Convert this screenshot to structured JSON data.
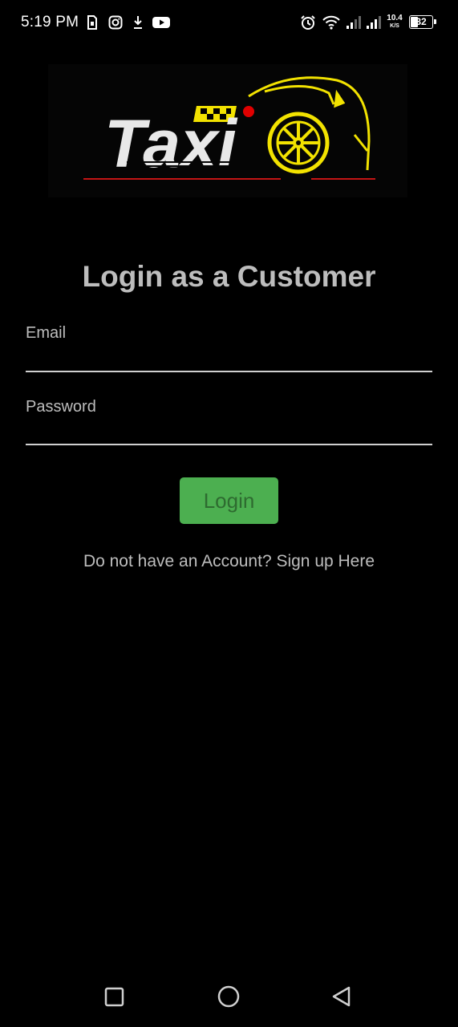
{
  "status_bar": {
    "time": "5:19 PM",
    "net_speed_value": "10.4",
    "net_speed_unit": "K/S",
    "battery": "32",
    "icons": [
      "sim-icon",
      "instagram-icon",
      "download-icon",
      "youtube-icon",
      "alarm-icon",
      "wifi-icon",
      "signal-icon",
      "signal-icon-2",
      "battery-icon"
    ]
  },
  "logo": {
    "text": "Taxi",
    "colors": {
      "text": "#e8e8e8",
      "accent": "#f2e200",
      "line": "#c41515",
      "dot": "#e00000"
    }
  },
  "login": {
    "title": "Login as a Customer",
    "email_label": "Email",
    "email_value": "",
    "password_label": "Password",
    "password_value": "",
    "button_label": "Login",
    "signup_text": "Do not have an Account? Sign up Here"
  },
  "nav_bar": {
    "icons": [
      "recents-square-icon",
      "home-circle-icon",
      "back-triangle-icon"
    ]
  },
  "colors": {
    "background": "#000000",
    "text_muted": "#bdbdbd",
    "button": "#4caf50",
    "button_text": "#2e6b30"
  }
}
